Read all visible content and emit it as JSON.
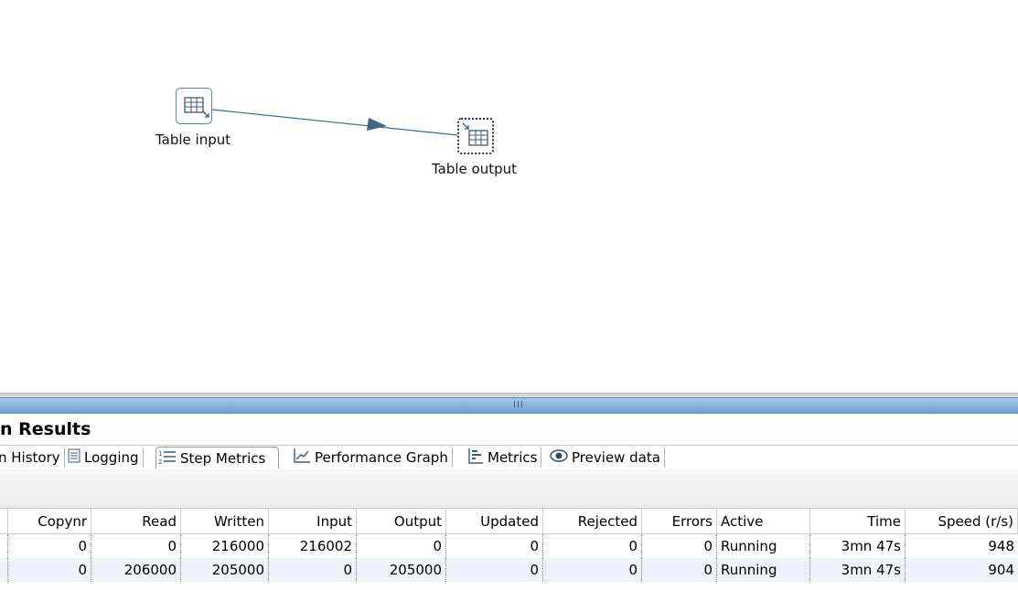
{
  "canvas": {
    "steps": [
      {
        "label": "Table input",
        "icon": "table-input-icon"
      },
      {
        "label": "Table output",
        "icon": "table-output-icon"
      }
    ],
    "hop_color": "#3f6684"
  },
  "sash": {
    "grip": "III"
  },
  "results": {
    "title": "n Results",
    "tabs": [
      {
        "label": "n History",
        "icon": "execution-history-icon"
      },
      {
        "label": "Logging",
        "icon": "logging-icon"
      },
      {
        "label": "Step Metrics",
        "icon": "step-metrics-icon",
        "active": true
      },
      {
        "label": "Performance Graph",
        "icon": "performance-graph-icon"
      },
      {
        "label": "Metrics",
        "icon": "metrics-icon"
      },
      {
        "label": "Preview data",
        "icon": "preview-data-icon"
      }
    ]
  },
  "metrics_table": {
    "columns": [
      "",
      "Copynr",
      "Read",
      "Written",
      "Input",
      "Output",
      "Updated",
      "Rejected",
      "Errors",
      "Active",
      "Time",
      "Speed (r/s)"
    ],
    "rows": [
      [
        "",
        "0",
        "0",
        "216000",
        "216002",
        "0",
        "0",
        "0",
        "0",
        "Running",
        "3mn 47s",
        "948"
      ],
      [
        "",
        "0",
        "206000",
        "205000",
        "0",
        "205000",
        "0",
        "0",
        "0",
        "Running",
        "3mn 47s",
        "904"
      ]
    ]
  },
  "colors": {
    "accent": "#6f9fd3",
    "selected_row": "#eef4fb",
    "step_border": "#5d86a6"
  }
}
